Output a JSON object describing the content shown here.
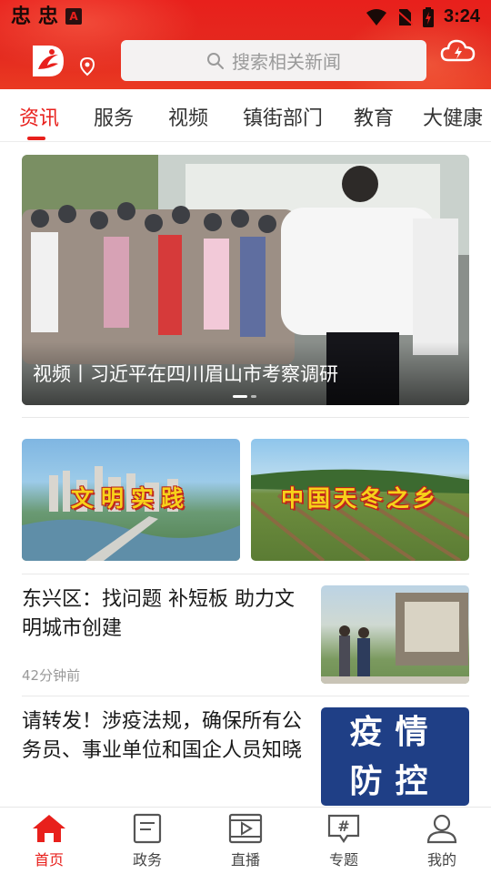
{
  "status_bar": {
    "notifications": [
      "忠",
      "忠"
    ],
    "time": "3:24"
  },
  "header": {
    "search_placeholder": "搜索相关新闻",
    "icons": [
      "app-logo",
      "location-icon",
      "search-icon",
      "weather-cloud-icon"
    ]
  },
  "tabs": [
    {
      "label": "资讯",
      "active": true
    },
    {
      "label": "服务",
      "active": false
    },
    {
      "label": "视频",
      "active": false
    },
    {
      "label": "镇街部门",
      "active": false
    },
    {
      "label": "教育",
      "active": false
    },
    {
      "label": "大健康",
      "active": false
    }
  ],
  "hero": {
    "title": "视频丨习近平在四川眉山市考察调研",
    "slide_count": 2,
    "active_slide": 1
  },
  "banners": [
    {
      "text": "文明实践"
    },
    {
      "text": "中国天冬之乡"
    }
  ],
  "news": [
    {
      "title": "东兴区：找问题 补短板 助力文明城市创建",
      "time": "42分钟前",
      "thumb": "photo"
    },
    {
      "title": "请转发！涉疫法规，确保所有公务员、事业单位和国企人员知晓",
      "time": "",
      "thumb_text": "疫情防控"
    }
  ],
  "bottom_nav": [
    {
      "label": "首页",
      "icon": "home-icon",
      "active": true
    },
    {
      "label": "政务",
      "icon": "document-icon",
      "active": false
    },
    {
      "label": "直播",
      "icon": "film-play-icon",
      "active": false
    },
    {
      "label": "专题",
      "icon": "hashtag-icon",
      "active": false
    },
    {
      "label": "我的",
      "icon": "user-icon",
      "active": false
    }
  ],
  "colors": {
    "brand_red": "#e8201c",
    "epidemic_blue": "#1f3f86"
  }
}
